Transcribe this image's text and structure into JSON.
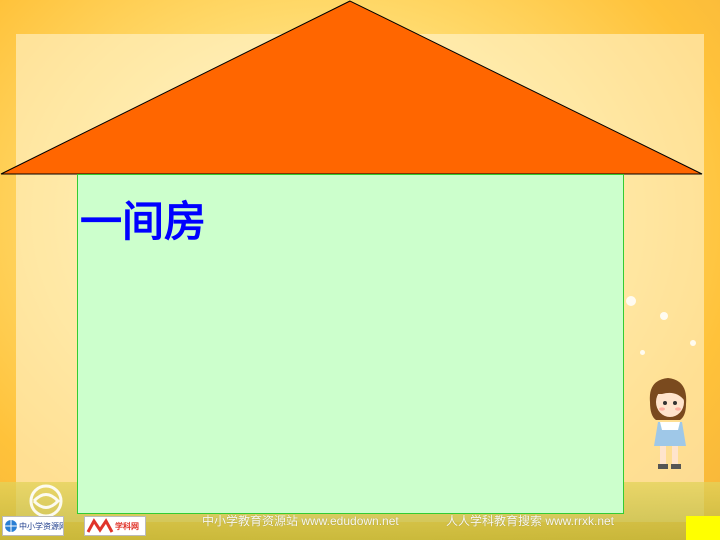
{
  "slide": {
    "title": "一间房"
  },
  "colors": {
    "roof": "#ff6600",
    "wall": "#ccffcc",
    "title": "#0000ff",
    "background": "#ffd96a",
    "corner": "#ffff00"
  },
  "footer": {
    "logo_left_text": "中小学资源网",
    "logo_right_text": "学科网",
    "watermark_left": "中小学教育资源站 www.edudown.net",
    "watermark_right": "人人学科教育搜索 www.rrxk.net"
  }
}
